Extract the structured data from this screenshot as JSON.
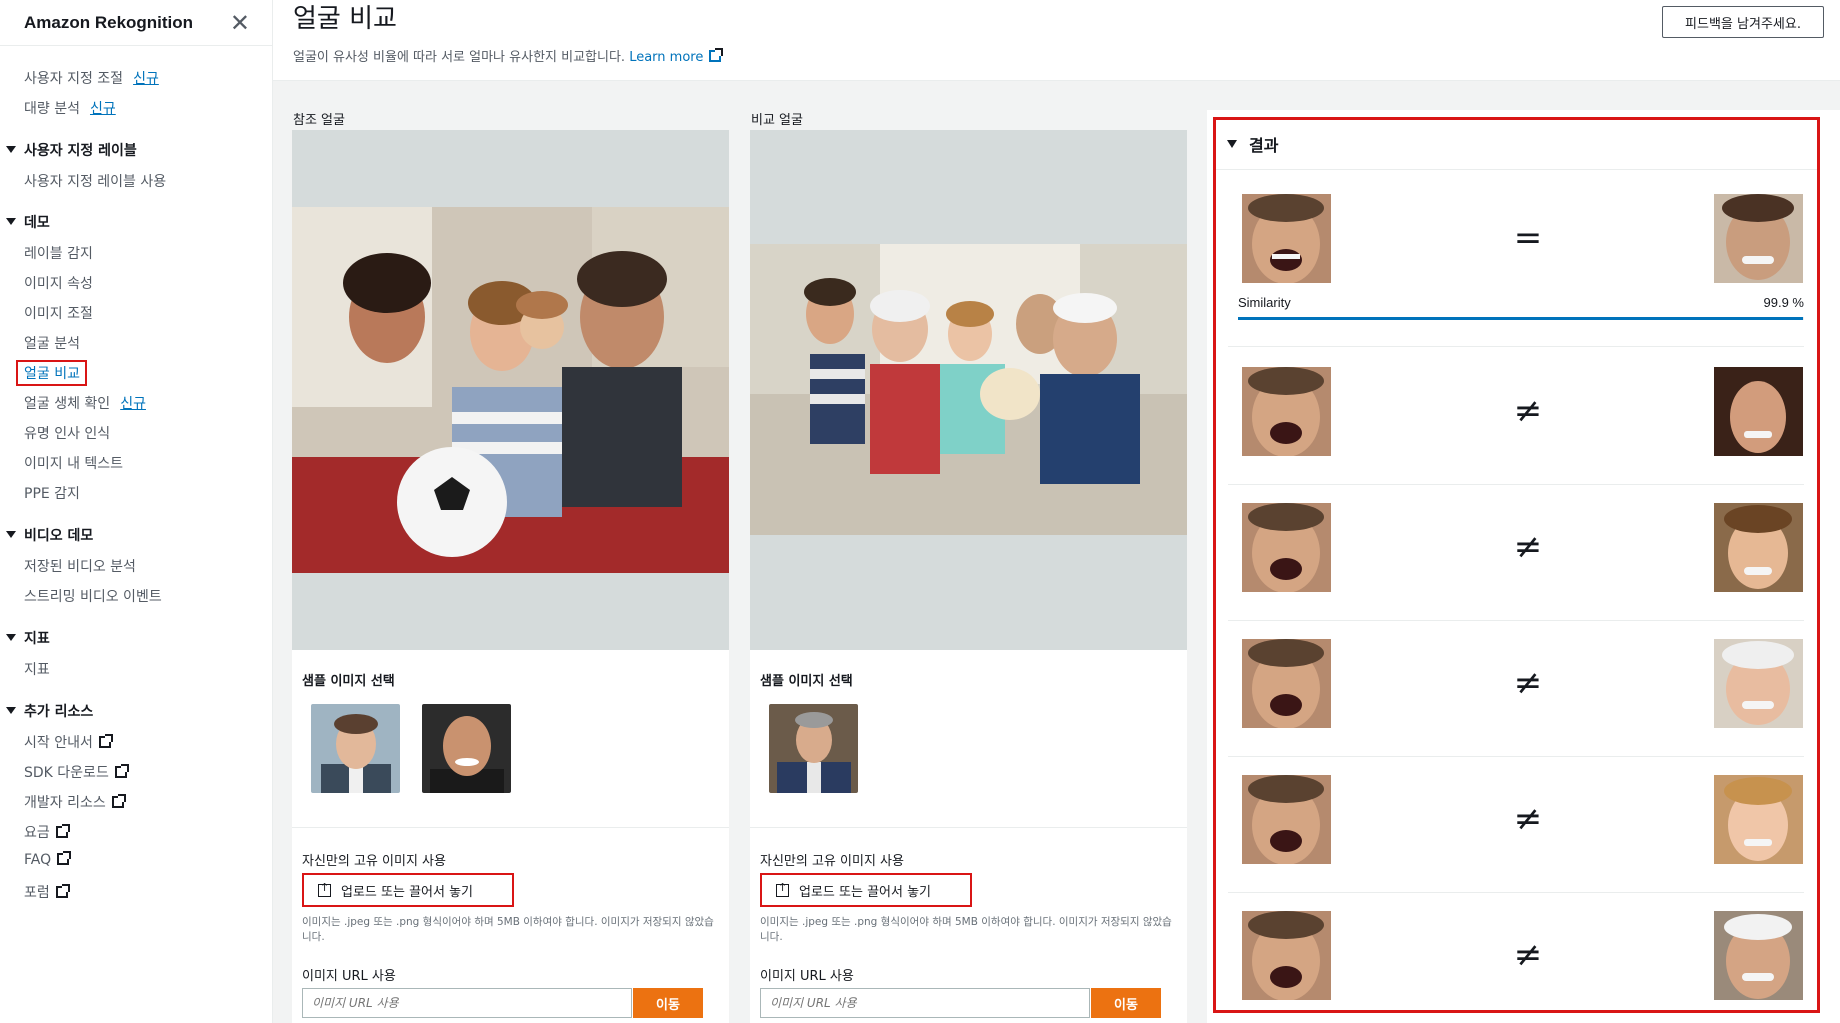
{
  "sidebar": {
    "title": "Amazon Rekognition",
    "top_items": [
      {
        "label": "사용자 지정 조절",
        "badge": "신규"
      },
      {
        "label": "대량 분석",
        "badge": "신규"
      }
    ],
    "sections": [
      {
        "title": "사용자 지정 레이블",
        "items": [
          {
            "label": "사용자 지정 레이블 사용"
          }
        ]
      },
      {
        "title": "데모",
        "items": [
          {
            "label": "레이블 감지"
          },
          {
            "label": "이미지 속성"
          },
          {
            "label": "이미지 조절"
          },
          {
            "label": "얼굴 분석"
          },
          {
            "label": "얼굴 비교"
          },
          {
            "label": "얼굴 생체 확인",
            "badge": "신규"
          },
          {
            "label": "유명 인사 인식"
          },
          {
            "label": "이미지 내 텍스트"
          },
          {
            "label": "PPE 감지"
          }
        ]
      },
      {
        "title": "비디오 데모",
        "items": [
          {
            "label": "저장된 비디오 분석"
          },
          {
            "label": "스트리밍 비디오 이벤트"
          }
        ]
      },
      {
        "title": "지표",
        "items": [
          {
            "label": "지표"
          }
        ]
      },
      {
        "title": "추가 리소스",
        "items": [
          {
            "label": "시작 안내서"
          },
          {
            "label": "SDK 다운로드"
          },
          {
            "label": "개발자 리소스"
          },
          {
            "label": "요금"
          },
          {
            "label": "FAQ"
          },
          {
            "label": "포럼"
          }
        ]
      }
    ],
    "active": "얼굴 비교"
  },
  "header": {
    "title": "얼굴 비교",
    "description": "얼굴이 유사성 비율에 따라 서로 얼마나 유사한지 비교합니다.",
    "learn_more": "Learn more",
    "feedback": "피드백을 남겨주세요."
  },
  "panels": [
    {
      "label": "참조 얼굴",
      "sample_title": "샘플 이미지 선택",
      "own_title": "자신만의 고유 이미지 사용",
      "upload": "업로드 또는 끌어서 놓기",
      "hint": "이미지는 .jpeg 또는 .png 형식이어야 하며 5MB 이하여야 합니다. 이미지가 저장되지 않았습니다.",
      "url_title": "이미지 URL 사용",
      "url_placeholder": "이미지 URL 사용",
      "go": "이동"
    },
    {
      "label": "비교 얼굴",
      "sample_title": "샘플 이미지 선택",
      "own_title": "자신만의 고유 이미지 사용",
      "upload": "업로드 또는 끌어서 놓기",
      "hint": "이미지는 .jpeg 또는 .png 형식이어야 하며 5MB 이하여야 합니다. 이미지가 저장되지 않았습니다.",
      "url_title": "이미지 URL 사용",
      "url_placeholder": "이미지 URL 사용",
      "go": "이동"
    }
  ],
  "results": {
    "title": "결과",
    "match": {
      "operator": "=",
      "similarity_label": "Similarity",
      "similarity_value": "99.9 %",
      "similarity_fraction": 0.999
    },
    "non_matches": [
      {
        "operator": "≠"
      },
      {
        "operator": "≠"
      },
      {
        "operator": "≠"
      },
      {
        "operator": "≠"
      },
      {
        "operator": "≠"
      }
    ]
  },
  "colors": {
    "accent": "#0073bb",
    "highlight": "#d91515",
    "button": "#ec7211"
  }
}
